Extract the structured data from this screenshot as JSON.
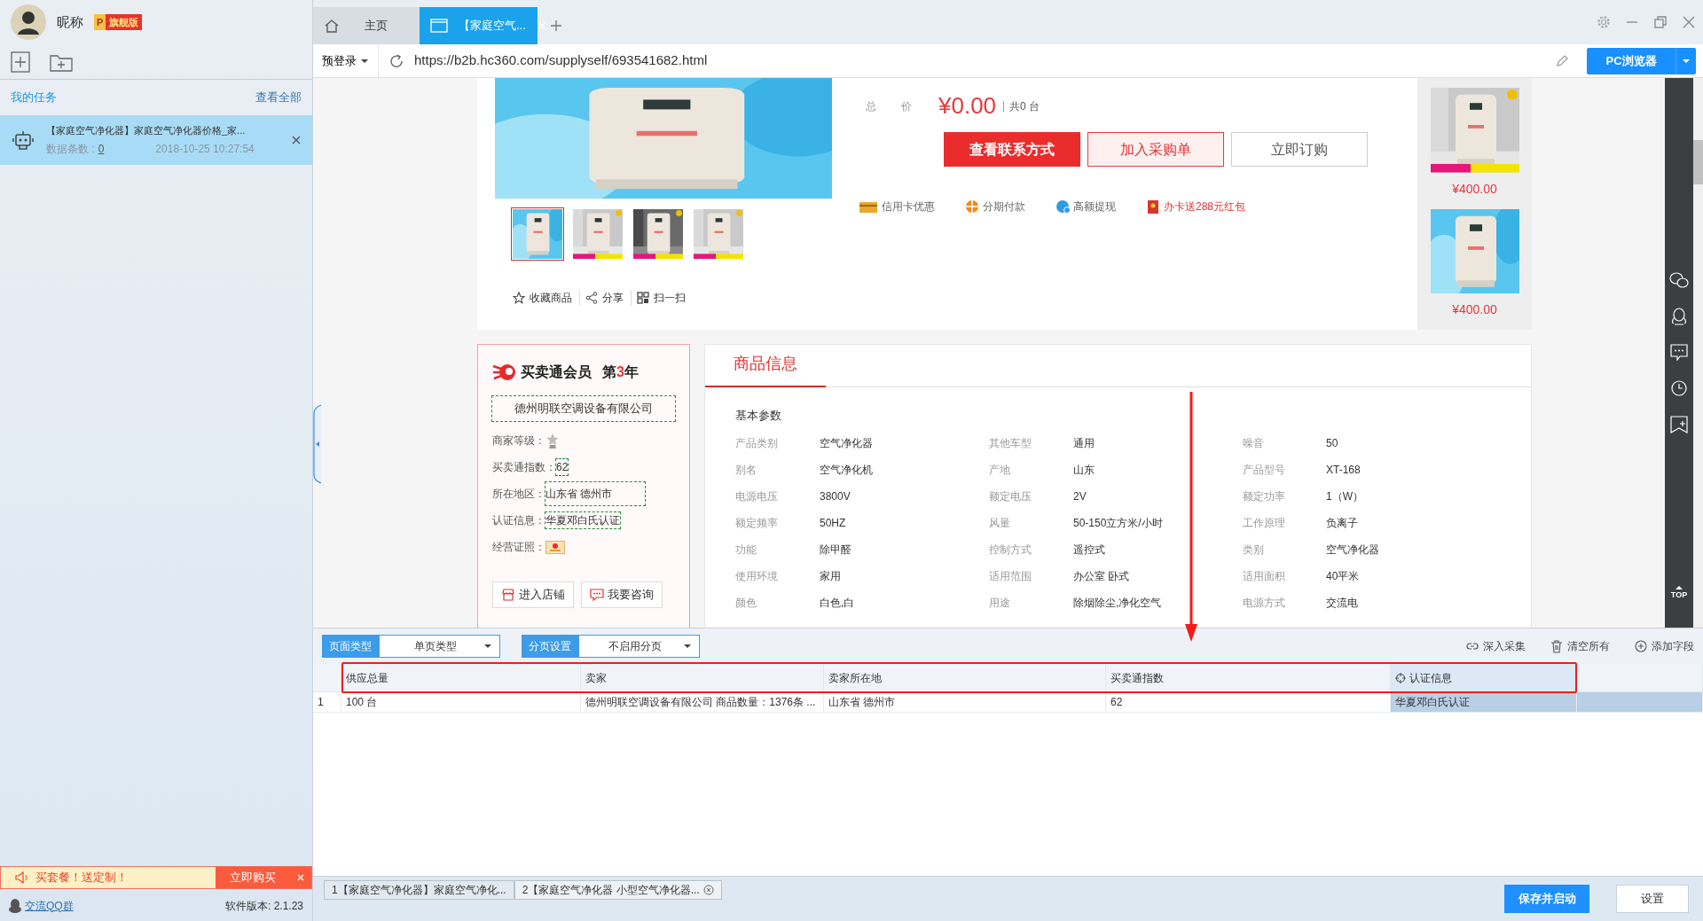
{
  "user": {
    "nickname": "昵称",
    "badge_letter": "P",
    "badge": "旗舰版"
  },
  "tasks_header": {
    "title": "我的任务",
    "link": "查看全部"
  },
  "tasks": [
    {
      "title": "【家庭空气净化器】家庭空气净化器价格_家...",
      "count_label": "数据条数 :",
      "count": "0",
      "time": "2018-10-25 10:27:54",
      "selected": true
    }
  ],
  "promo": {
    "text": "买套餐！送定制！",
    "button": "立即购买"
  },
  "footer": {
    "qq_link": "交流QQ群",
    "version": "软件版本: 2.1.23"
  },
  "browser": {
    "tabs": [
      {
        "label": "主页",
        "kind": "home",
        "selected": false
      },
      {
        "label": "【家庭空气...",
        "kind": "page",
        "selected": true
      }
    ],
    "login": "预登录",
    "url": "https://b2b.hc360.com/supplyself/693541682.html",
    "mode_button": "PC浏览器"
  },
  "product": {
    "price_label": "总价",
    "price": "¥0.00",
    "quantity": "共0 台",
    "buttons": [
      {
        "label": "查看联系方式",
        "kind": "primary"
      },
      {
        "label": "加入采购单",
        "kind": "outline"
      },
      {
        "label": "立即订购",
        "kind": "plain"
      }
    ],
    "perks": [
      {
        "label": "信用卡优惠",
        "kind": "card"
      },
      {
        "label": "分期付款",
        "kind": "installment"
      },
      {
        "label": "高额提现",
        "kind": "cash"
      },
      {
        "label": "办卡送288元红包",
        "kind": "redpacket"
      }
    ],
    "thumbnails": [
      {
        "selected": true
      },
      {
        "selected": false
      },
      {
        "selected": false
      },
      {
        "selected": false
      }
    ],
    "actions": [
      {
        "label": "收藏商品",
        "kind": "star"
      },
      {
        "label": "分享",
        "kind": "share"
      },
      {
        "label": "扫一扫",
        "kind": "scan"
      }
    ],
    "recommended": [
      {
        "price": "¥400.00"
      },
      {
        "price": "¥400.00"
      }
    ]
  },
  "seller": {
    "member": "买卖通会员",
    "term": {
      "before": "第",
      "number": "3",
      "after": "年"
    },
    "company": {
      "name": "德州明联空调设备有限公司",
      "highlighted": true
    },
    "fields": [
      {
        "label": "商家等级：",
        "kind": "medal",
        "highlighted": false
      },
      {
        "label": "买卖通指数：",
        "kind": "text",
        "value": "62",
        "highlighted": true
      },
      {
        "label": "所在地区：",
        "kind": "text",
        "value": "山东省 德州市",
        "highlighted": true
      },
      {
        "label": "认证信息：",
        "kind": "text",
        "value": "华夏邓白氏认证",
        "highlighted": true
      },
      {
        "label": "经营证照：",
        "kind": "license",
        "highlighted": false
      }
    ],
    "buttons": [
      {
        "label": "进入店铺",
        "kind": "shop"
      },
      {
        "label": "我要咨询",
        "kind": "chat"
      }
    ]
  },
  "info": {
    "tab": "商品信息",
    "section": "基本参数",
    "params": [
      {
        "label": "产品类别",
        "value": "空气净化器"
      },
      {
        "label": "其他车型",
        "value": "通用"
      },
      {
        "label": "噪音",
        "value": "50"
      },
      {
        "label": "别名",
        "value": "空气净化机"
      },
      {
        "label": "产地",
        "value": "山东"
      },
      {
        "label": "产品型号",
        "value": "XT-168"
      },
      {
        "label": "电源电压",
        "value": "3800V"
      },
      {
        "label": "额定电压",
        "value": "2V"
      },
      {
        "label": "额定功率",
        "value": "1（W）"
      },
      {
        "label": "额定频率",
        "value": "50HZ"
      },
      {
        "label": "风量",
        "value": "50-150立方米/小时"
      },
      {
        "label": "工作原理",
        "value": "负离子"
      },
      {
        "label": "功能",
        "value": "除甲醛"
      },
      {
        "label": "控制方式",
        "value": "遥控式"
      },
      {
        "label": "类别",
        "value": "空气净化器"
      },
      {
        "label": "使用环境",
        "value": "家用"
      },
      {
        "label": "适用范围",
        "value": "办公室 卧式"
      },
      {
        "label": "适用面积",
        "value": "40平米"
      },
      {
        "label": "颜色",
        "value": "白色,白"
      },
      {
        "label": "用途",
        "value": "除烟除尘,净化空气"
      },
      {
        "label": "电源方式",
        "value": "交流电"
      }
    ]
  },
  "side_toolbar": {
    "top": "TOP"
  },
  "collector": {
    "selects": [
      {
        "label": "页面类型",
        "value": "单页类型"
      },
      {
        "label": "分页设置",
        "value": "不启用分页"
      }
    ],
    "actions": [
      {
        "label": "深入采集",
        "kind": "link"
      },
      {
        "label": "清空所有",
        "kind": "trash"
      },
      {
        "label": "添加字段",
        "kind": "add"
      }
    ],
    "columns": [
      {
        "label": "供应总量",
        "selected": false
      },
      {
        "label": "卖家",
        "selected": false
      },
      {
        "label": "卖家所在地",
        "selected": false
      },
      {
        "label": "买卖通指数",
        "selected": false
      },
      {
        "label": "认证信息",
        "selected": true
      }
    ],
    "rows": [
      {
        "index": "1",
        "cells": [
          "100 台",
          "德州明联空调设备有限公司 商品数量：1376条 ...",
          "山东省 德州市",
          "62",
          "华夏邓白氏认证"
        ]
      }
    ]
  },
  "bottom_tabs": [
    {
      "label": "1【家庭空气净化器】家庭空气净化...",
      "selected": false,
      "closable": false
    },
    {
      "label": "2【家庭空气净化器 小型空气净化器...",
      "selected": true,
      "closable": true
    }
  ],
  "bottom_buttons": [
    {
      "label": "保存并启动",
      "kind": "primary"
    },
    {
      "label": "设置",
      "kind": "plain"
    }
  ]
}
